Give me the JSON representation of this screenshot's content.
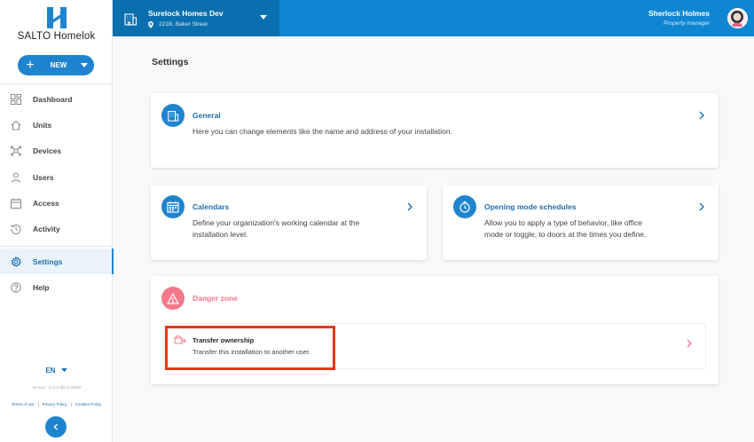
{
  "app": {
    "name": "SALTO Homelok"
  },
  "sidebar": {
    "new_label": "NEW",
    "items": [
      {
        "label": "Dashboard",
        "icon": "dashboard-icon"
      },
      {
        "label": "Units",
        "icon": "home-icon"
      },
      {
        "label": "Devices",
        "icon": "devices-icon"
      },
      {
        "label": "Users",
        "icon": "user-icon"
      },
      {
        "label": "Access",
        "icon": "access-icon"
      },
      {
        "label": "Activity",
        "icon": "history-icon"
      },
      {
        "label": "Settings",
        "icon": "gear-icon",
        "active": true
      },
      {
        "label": "Help",
        "icon": "help-icon"
      }
    ],
    "language": "EN",
    "version": "Version: v1.0.0-dfa.7c2829f",
    "terms": "Terms of use",
    "privacy": "Privacy Policy",
    "cookies": "Cookies Policy"
  },
  "header": {
    "site_name": "Surelock Homes Dev",
    "site_address": "221B, Baker Street",
    "user_name": "Sherlock Holmes",
    "user_role": "Property manager"
  },
  "main": {
    "title": "Settings",
    "general": {
      "title": "General",
      "description": "Here you can change elements like the name and address of your installation."
    },
    "calendars": {
      "title": "Calendars",
      "description_line1": "Define your organization's working calendar at the",
      "description_line2": "installation level."
    },
    "opening_modes": {
      "title": "Opening mode schedules",
      "description_line1": "Allow you to apply a type of behavior, like office",
      "description_line2": "mode or toggle, to doors at the times you define."
    },
    "danger_zone": {
      "title": "Danger zone",
      "transfer_title": "Transfer ownership",
      "transfer_description": "Transfer this installation to another user."
    }
  },
  "colors": {
    "primary": "#1f84d0",
    "header": "#0e86d2",
    "danger": "#f2788a",
    "highlight": "#e8361c"
  }
}
